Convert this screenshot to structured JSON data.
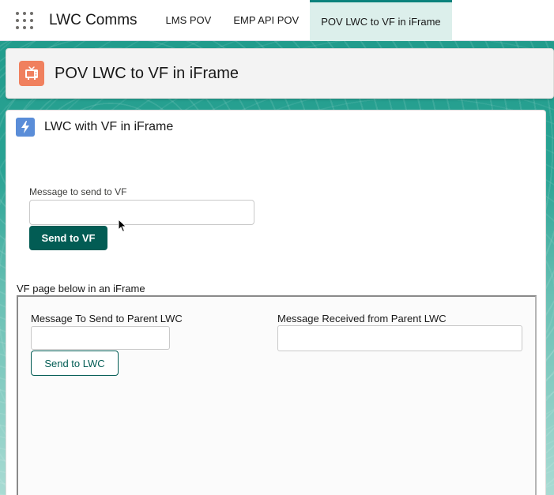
{
  "navbar": {
    "app_launcher_icon": "app-launcher-grid-icon",
    "app_name": "LWC Comms",
    "tabs": [
      {
        "label": "LMS POV",
        "active": false
      },
      {
        "label": "EMP API POV",
        "active": false
      },
      {
        "label": "POV LWC to VF in iFrame",
        "active": true
      }
    ]
  },
  "page_header": {
    "icon": "tv-icon",
    "icon_color": "#f0805e",
    "title": "POV LWC to VF in iFrame"
  },
  "card": {
    "icon": "lightning-icon",
    "icon_color": "#5a8dd8",
    "title": "LWC with VF in iFrame",
    "message_label": "Message to send to VF",
    "message_value": "",
    "send_button_label": "Send to VF",
    "iframe_label": "VF page below in an iFrame"
  },
  "vf_page": {
    "send_label": "Message To Send to Parent LWC",
    "send_value": "",
    "send_button_label": "Send to LWC",
    "received_label": "Message Received from Parent LWC",
    "received_value": ""
  },
  "colors": {
    "brand_dark_teal": "#025c54",
    "active_tab_bg": "#dcefeb"
  }
}
